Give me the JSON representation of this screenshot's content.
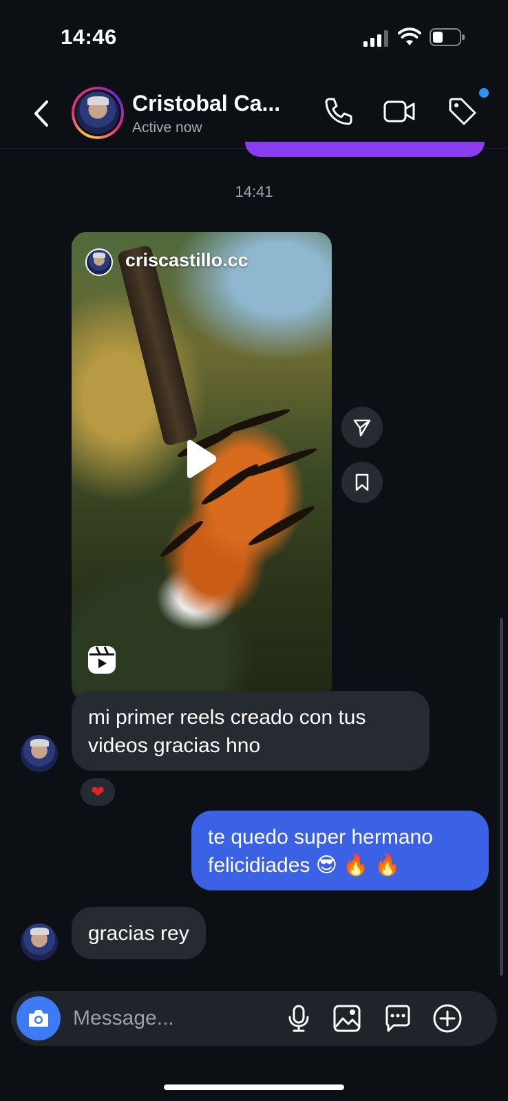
{
  "status_bar": {
    "time": "14:46"
  },
  "header": {
    "contact_name": "Cristobal Ca...",
    "contact_status": "Active now",
    "icons": [
      "back-chevron-icon",
      "phone-icon",
      "video-camera-icon",
      "tag-icon"
    ]
  },
  "thread": {
    "timestamp": "14:41",
    "reel": {
      "username": "criscastillo.cc"
    },
    "messages": [
      {
        "direction": "in",
        "text": "mi primer reels creado con tus videos gracias hno",
        "reaction": "❤"
      },
      {
        "direction": "out",
        "text": "te quedo super hermano felicidiades 😎 🔥 🔥"
      },
      {
        "direction": "in",
        "text": "gracias rey"
      }
    ]
  },
  "composer": {
    "placeholder": "Message...",
    "icons": [
      "camera-icon",
      "microphone-icon",
      "gallery-icon",
      "sticker-chat-icon",
      "plus-icon"
    ]
  },
  "colors": {
    "background": "#0c0f14",
    "incoming_bubble": "#262a31",
    "outgoing_bubble": "#3b61e4",
    "accent_blue": "#3d7bf4",
    "purple": "#8b3bf0"
  }
}
